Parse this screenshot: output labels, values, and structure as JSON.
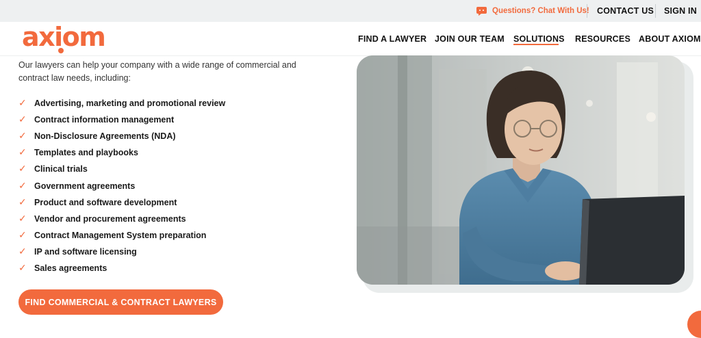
{
  "topbar": {
    "chat_label": "Questions? Chat With Us!",
    "contact_label": "CONTACT US",
    "signin_label": "SIGN IN"
  },
  "brand": {
    "logo_text": "axiom",
    "accent_color": "#f26a3d"
  },
  "nav": {
    "items": [
      {
        "label": "FIND A LAWYER",
        "active": false
      },
      {
        "label": "JOIN OUR TEAM",
        "active": false
      },
      {
        "label": "SOLUTIONS",
        "active": true
      },
      {
        "label": "RESOURCES",
        "active": false
      },
      {
        "label": "ABOUT AXIOM",
        "active": false
      }
    ]
  },
  "content": {
    "intro": "Our lawyers can help your company with a wide range of commercial and contract law needs, including:",
    "check_icon": "✓",
    "items": [
      "Advertising, marketing and promotional review",
      "Contract information management",
      "Non-Disclosure Agreements (NDA)",
      "Templates and playbooks",
      "Clinical trials",
      "Government agreements",
      "Product and software development",
      "Vendor and procurement agreements",
      "Contract Management System preparation",
      "IP and software licensing",
      "Sales agreements"
    ],
    "cta_label": "FIND COMMERCIAL & CONTRACT LAWYERS"
  },
  "icons": {
    "chat": "chat-bubble-icon",
    "check": "checkmark-icon"
  }
}
